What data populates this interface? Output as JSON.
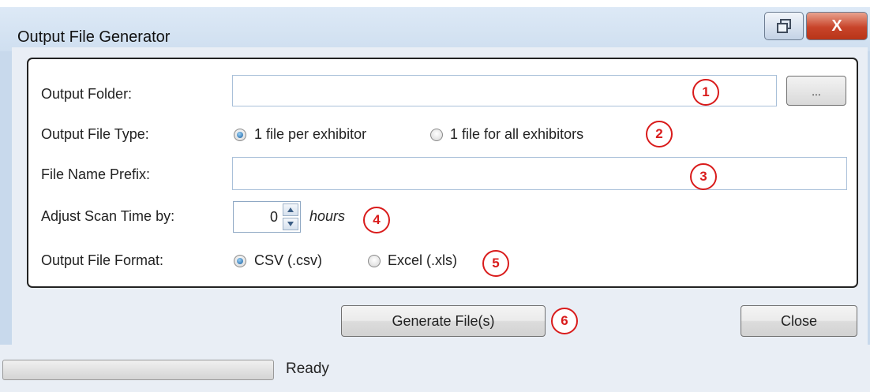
{
  "window": {
    "title": "Output File Generator",
    "close_glyph": "X"
  },
  "form": {
    "output_folder": {
      "label": "Output Folder:",
      "value": "",
      "browse_label": "..."
    },
    "output_file_type": {
      "label": "Output File Type:",
      "options": [
        "1 file per exhibitor",
        "1 file for all exhibitors"
      ],
      "selected": 0
    },
    "file_name_prefix": {
      "label": "File Name Prefix:",
      "value": ""
    },
    "adjust_scan_time": {
      "label": "Adjust Scan Time by:",
      "value": "0",
      "unit": "hours"
    },
    "output_file_format": {
      "label": "Output File Format:",
      "options": [
        "CSV (.csv)",
        "Excel (.xls)"
      ],
      "selected": 0
    }
  },
  "annotations": [
    "1",
    "2",
    "3",
    "4",
    "5",
    "6"
  ],
  "buttons": {
    "generate": "Generate File(s)",
    "close": "Close"
  },
  "status": {
    "text": "Ready",
    "progress": 0
  },
  "colors": {
    "badge": "#d91b1b",
    "window_frame": "#c8d9ec",
    "close_button": "#c8442a"
  }
}
